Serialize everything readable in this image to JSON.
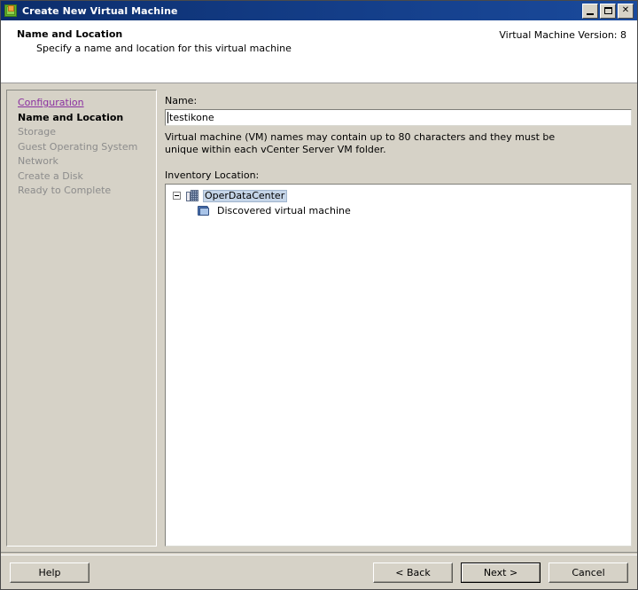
{
  "window": {
    "title": "Create New Virtual Machine",
    "icon": "vm-icon",
    "controls": {
      "minimize": "minimize-button",
      "maximize": "maximize-button",
      "close_label": "✕"
    }
  },
  "header": {
    "title": "Name and Location",
    "subtitle": "Specify a name and location for this virtual machine",
    "version": "Virtual Machine Version: 8"
  },
  "sidebar": {
    "items": [
      {
        "label": "Configuration",
        "state": "link"
      },
      {
        "label": "Name and Location",
        "state": "current"
      },
      {
        "label": "Storage",
        "state": "pending"
      },
      {
        "label": "Guest Operating System",
        "state": "pending"
      },
      {
        "label": "Network",
        "state": "pending"
      },
      {
        "label": "Create a Disk",
        "state": "pending"
      },
      {
        "label": "Ready to Complete",
        "state": "pending"
      }
    ]
  },
  "main": {
    "name_label": "Name:",
    "name_value": "testikone",
    "name_placeholder": "",
    "help_text": "Virtual machine (VM) names may contain up to 80 characters and they must be unique within each vCenter Server VM folder.",
    "inventory_label": "Inventory Location:",
    "tree": [
      {
        "label": "OperDataCenter",
        "icon": "datacenter-icon",
        "level": 0,
        "expanded": true,
        "selected": true
      },
      {
        "label": "Discovered virtual machine",
        "icon": "folder-icon",
        "level": 1,
        "expanded": false,
        "selected": false
      }
    ]
  },
  "footer": {
    "help": "Help",
    "back": "< Back",
    "next": "Next >",
    "cancel": "Cancel"
  },
  "colors": {
    "titlebar": "#0c2d6b",
    "face": "#d6d2c7",
    "link": "#8a2fa0",
    "selection": "#c5d5e8",
    "field_bg": "#ffffff"
  }
}
